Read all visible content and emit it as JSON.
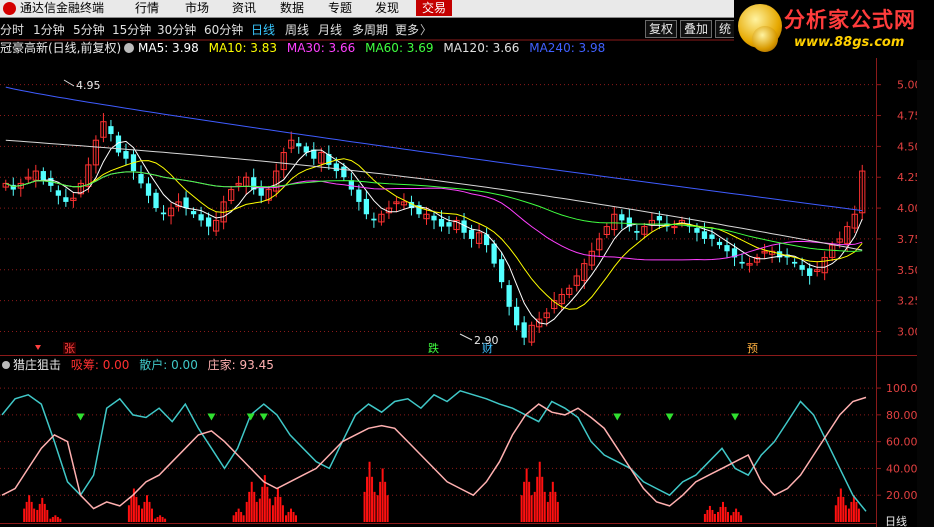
{
  "window_title": "通达信金融终端",
  "menu": {
    "items": [
      "行情",
      "市场",
      "资讯",
      "数据",
      "专题",
      "发现",
      "交易"
    ],
    "active": "交易"
  },
  "periods": {
    "items": [
      "分时",
      "1分钟",
      "5分钟",
      "15分钟",
      "30分钟",
      "60分钟",
      "日线",
      "周线",
      "月线",
      "多周期",
      "更多"
    ],
    "selected": "日线",
    "more_arrow": "〉"
  },
  "toolbar": {
    "restore_right_label": "复权",
    "overlay_label": "叠加",
    "stats_label": "统"
  },
  "stock_header": {
    "name": "冠豪高新(日线,前复权)",
    "ma_items": [
      {
        "label": "MA5: 3.98",
        "color": "#ffffff"
      },
      {
        "label": "MA10: 3.83",
        "color": "#ffff00"
      },
      {
        "label": "MA30: 3.66",
        "color": "#ff40ff"
      },
      {
        "label": "MA60: 3.69",
        "color": "#40ff40"
      },
      {
        "label": "MA120: 3.66",
        "color": "#e0e0e0"
      },
      {
        "label": "MA240: 3.98",
        "color": "#4060ff"
      }
    ]
  },
  "price_axis": {
    "ticks": [
      "5.00",
      "4.75",
      "4.50",
      "4.25",
      "4.00",
      "3.75",
      "3.50",
      "3.25",
      "3.00"
    ],
    "values": [
      5.0,
      4.75,
      4.5,
      4.25,
      4.0,
      3.75,
      3.5,
      3.25,
      3.0
    ],
    "ylim": [
      2.85,
      5.2
    ]
  },
  "annotations": {
    "high_label": "4.95",
    "low_label": "2.90",
    "markers": [
      {
        "text": "张",
        "color": "#ff4040"
      },
      {
        "text": "跌",
        "color": "#40ff40"
      },
      {
        "text": "财",
        "color": "#40c0ff"
      },
      {
        "text": "预",
        "color": "#ffb040"
      }
    ]
  },
  "indicator": {
    "name": "猎庄狙击",
    "items": [
      {
        "label": "吸筹: 0.00",
        "color": "#ff3030"
      },
      {
        "label": "散户: 0.00",
        "color": "#40c8c8"
      },
      {
        "label": "庄家: 93.45",
        "color": "#ffb0b0"
      }
    ],
    "axis_ticks": [
      "100.0",
      "80.00",
      "60.00",
      "40.00",
      "20.00"
    ],
    "axis_values": [
      100,
      80,
      60,
      40,
      20
    ],
    "ylim": [
      0,
      112
    ]
  },
  "bottom_right_label": "日线",
  "colors": {
    "up": "#ff3232",
    "down": "#54ffff",
    "grid": "#8b1a1a",
    "ma5": "#ffffff",
    "ma10": "#ffff00",
    "ma30": "#ff40ff",
    "ma60": "#40ff40",
    "ma120": "#d8d8d8",
    "ma240": "#3f5cff",
    "retail": "#40c8c8",
    "dealer": "#ffb0b0",
    "accumulate": "#ff1010"
  },
  "watermark": {
    "title": "分析家公式网",
    "url": "www.88gs.com"
  },
  "chart_data": [
    {
      "type": "candlestick",
      "title": "冠豪高新(日线,前复权)",
      "series_key_prices": [
        {
          "name": "close",
          "values": [
            4.2,
            4.15,
            4.2,
            4.25,
            4.3,
            4.22,
            4.18,
            4.1,
            4.05,
            4.08,
            4.2,
            4.35,
            4.55,
            4.7,
            4.6,
            4.45,
            4.4,
            4.3,
            4.2,
            4.1,
            4.0,
            3.95,
            4.0,
            4.05,
            4.0,
            3.95,
            3.9,
            3.85,
            3.9,
            4.05,
            4.15,
            4.2,
            4.25,
            4.15,
            4.1,
            4.15,
            4.3,
            4.45,
            4.55,
            4.5,
            4.45,
            4.4,
            4.45,
            4.35,
            4.3,
            4.25,
            4.15,
            4.05,
            3.95,
            3.9,
            3.95,
            4.0,
            4.05,
            4.05,
            4.0,
            3.95,
            3.95,
            3.9,
            3.85,
            3.85,
            3.9,
            3.8,
            3.75,
            3.8,
            3.7,
            3.55,
            3.4,
            3.2,
            3.05,
            2.95,
            3.05,
            3.1,
            3.15,
            3.25,
            3.3,
            3.35,
            3.45,
            3.55,
            3.65,
            3.75,
            3.85,
            3.95,
            3.9,
            3.85,
            3.8,
            3.85,
            3.9,
            3.9,
            3.85,
            3.85,
            3.9,
            3.85,
            3.8,
            3.75,
            3.75,
            3.7,
            3.65,
            3.6,
            3.55,
            3.55,
            3.6,
            3.65,
            3.65,
            3.6,
            3.6,
            3.55,
            3.5,
            3.45,
            3.5,
            3.6,
            3.7,
            3.75,
            3.85,
            3.95,
            4.3
          ]
        }
      ],
      "moving_averages": [
        "MA5: 3.98",
        "MA10: 3.83",
        "MA30: 3.66",
        "MA60: 3.69",
        "MA120: 3.66",
        "MA240: 3.98"
      ],
      "high": 4.95,
      "low": 2.9,
      "ylim": [
        2.85,
        5.2
      ]
    },
    {
      "type": "line",
      "title": "猎庄狙击",
      "series": [
        {
          "name": "散户",
          "values": [
            80,
            92,
            95,
            88,
            60,
            30,
            20,
            35,
            85,
            92,
            80,
            78,
            85,
            75,
            88,
            70,
            55,
            40,
            55,
            80,
            88,
            80,
            65,
            55,
            45,
            40,
            60,
            80,
            88,
            82,
            90,
            92,
            85,
            95,
            90,
            98,
            95,
            92,
            88,
            85,
            80,
            75,
            90,
            85,
            78,
            60,
            50,
            45,
            40,
            30,
            25,
            20,
            30,
            35,
            45,
            55,
            40,
            35,
            50,
            60,
            75,
            90,
            80,
            60,
            40,
            20,
            8
          ]
        },
        {
          "name": "庄家",
          "values": [
            20,
            25,
            40,
            55,
            65,
            60,
            20,
            10,
            15,
            12,
            20,
            30,
            35,
            45,
            55,
            65,
            68,
            60,
            50,
            40,
            30,
            25,
            30,
            35,
            40,
            50,
            60,
            65,
            70,
            72,
            70,
            60,
            50,
            40,
            30,
            25,
            20,
            30,
            45,
            65,
            80,
            88,
            82,
            80,
            85,
            78,
            70,
            55,
            40,
            25,
            15,
            12,
            20,
            30,
            35,
            40,
            45,
            50,
            30,
            20,
            25,
            35,
            50,
            65,
            80,
            90,
            93
          ]
        },
        {
          "name": "吸筹",
          "values": [
            0,
            0,
            20,
            18,
            5,
            0,
            0,
            0,
            0,
            0,
            25,
            20,
            5,
            0,
            0,
            0,
            0,
            0,
            10,
            30,
            35,
            25,
            10,
            0,
            0,
            0,
            0,
            0,
            45,
            40,
            0,
            0,
            0,
            0,
            0,
            0,
            0,
            0,
            0,
            0,
            40,
            45,
            30,
            0,
            0,
            0,
            0,
            0,
            0,
            0,
            0,
            0,
            0,
            0,
            12,
            15,
            10,
            0,
            0,
            0,
            0,
            0,
            0,
            0,
            25,
            20,
            0
          ]
        }
      ],
      "ylim": [
        0,
        112
      ]
    }
  ]
}
